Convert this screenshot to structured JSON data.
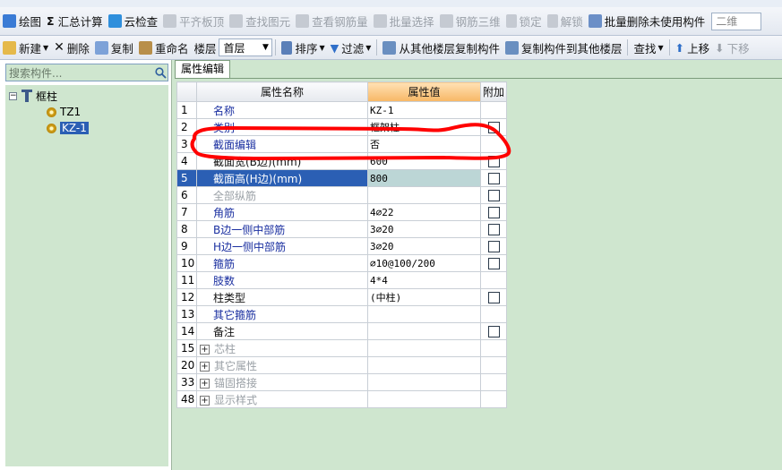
{
  "toolbar1": {
    "items": [
      "绘图",
      "汇总计算",
      "云检查",
      "平齐板顶",
      "查找图元",
      "查看钢筋量",
      "批量选择",
      "钢筋三维",
      "锁定",
      "解锁",
      "批量删除未使用构件"
    ],
    "view_combo": "二维"
  },
  "toolbar2": {
    "new": "新建",
    "delete": "删除",
    "copy": "复制",
    "rename": "重命名",
    "floor_label": "楼层",
    "floor_value": "首层",
    "sort": "排序",
    "filter": "过滤",
    "copy_from": "从其他楼层复制构件",
    "copy_to": "复制构件到其他楼层",
    "find": "查找",
    "move_up": "上移",
    "move_down": "下移"
  },
  "sidebar": {
    "search_placeholder": "搜索构件...",
    "tree": {
      "root": "框柱",
      "children": [
        "TZ1",
        "KZ-1"
      ],
      "selected": "KZ-1"
    }
  },
  "tab": "属性编辑",
  "grid": {
    "headers": [
      "属性名称",
      "属性值",
      "附加"
    ],
    "rows": [
      {
        "num": "1",
        "name": "名称",
        "value": "KZ-1",
        "checkbox": false,
        "style": "blue"
      },
      {
        "num": "2",
        "name": "类别",
        "value": "框架柱",
        "checkbox": true,
        "style": "blue"
      },
      {
        "num": "3",
        "name": "截面编辑",
        "value": "否",
        "checkbox": false,
        "style": "blue"
      },
      {
        "num": "4",
        "name": "截面宽(B边)(mm)",
        "value": "600",
        "checkbox": true,
        "style": "black"
      },
      {
        "num": "5",
        "name": "截面高(H边)(mm)",
        "value": "800",
        "checkbox": true,
        "style": "selected"
      },
      {
        "num": "6",
        "name": "全部纵筋",
        "value": "",
        "checkbox": true,
        "style": "gray"
      },
      {
        "num": "7",
        "name": "角筋",
        "value": "4⌀22",
        "checkbox": true,
        "style": "blue"
      },
      {
        "num": "8",
        "name": "B边一侧中部筋",
        "value": "3⌀20",
        "checkbox": true,
        "style": "blue"
      },
      {
        "num": "9",
        "name": "H边一侧中部筋",
        "value": "3⌀20",
        "checkbox": true,
        "style": "blue"
      },
      {
        "num": "10",
        "name": "箍筋",
        "value": "⌀10@100/200",
        "checkbox": true,
        "style": "blue"
      },
      {
        "num": "11",
        "name": "肢数",
        "value": "4*4",
        "checkbox": false,
        "style": "blue"
      },
      {
        "num": "12",
        "name": "柱类型",
        "value": "(中柱)",
        "checkbox": true,
        "style": "black"
      },
      {
        "num": "13",
        "name": "其它箍筋",
        "value": "",
        "checkbox": false,
        "style": "blue"
      },
      {
        "num": "14",
        "name": "备注",
        "value": "",
        "checkbox": true,
        "style": "black"
      },
      {
        "num": "15",
        "name": "芯柱",
        "value": "",
        "checkbox": false,
        "style": "group"
      },
      {
        "num": "20",
        "name": "其它属性",
        "value": "",
        "checkbox": false,
        "style": "group"
      },
      {
        "num": "33",
        "name": "锚固搭接",
        "value": "",
        "checkbox": false,
        "style": "group"
      },
      {
        "num": "48",
        "name": "显示样式",
        "value": "",
        "checkbox": false,
        "style": "group"
      }
    ]
  },
  "colors": {
    "background": "#cfe6cf",
    "selection": "#2b5fb4",
    "header_value": "#f7b765",
    "annotation": "#ff0000"
  }
}
